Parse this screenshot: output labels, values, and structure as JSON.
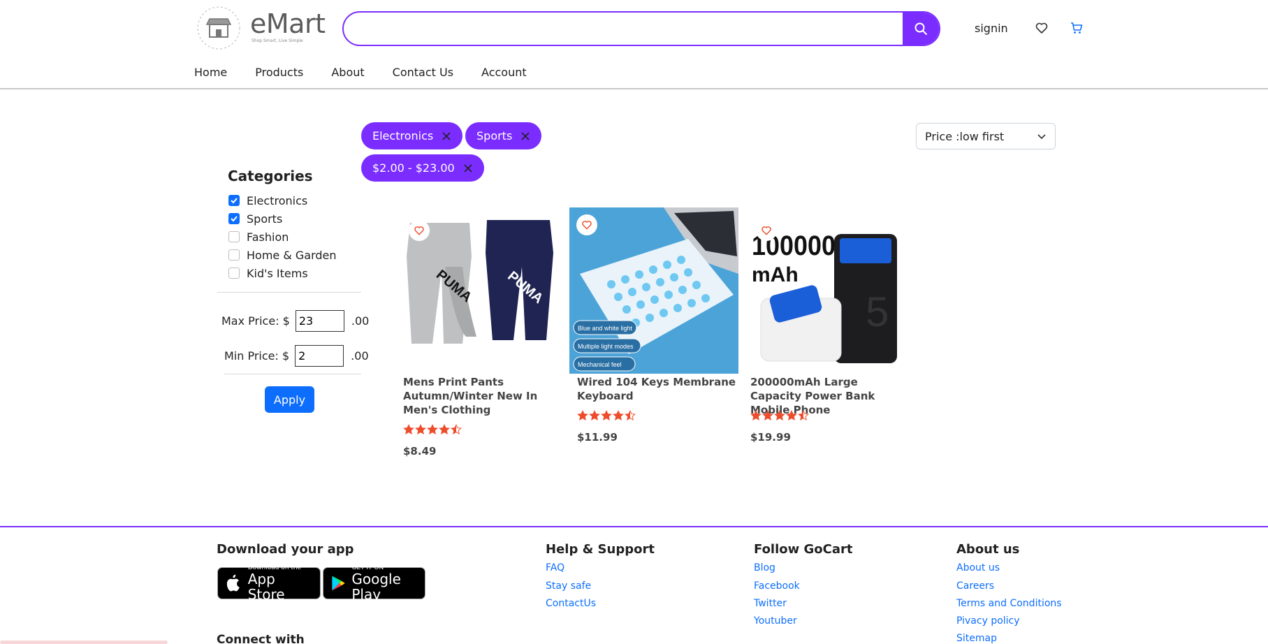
{
  "header": {
    "logo_text": "eMart",
    "logo_tagline": "Shop Smart, Live Simple",
    "search_placeholder": "",
    "signin_label": "signin"
  },
  "nav": [
    "Home",
    "Products",
    "About",
    "Contact Us",
    "Account"
  ],
  "filters": {
    "categories_title": "Categories",
    "categories": [
      {
        "label": "Electronics",
        "checked": true
      },
      {
        "label": "Sports",
        "checked": true
      },
      {
        "label": "Fashion",
        "checked": false
      },
      {
        "label": "Home & Garden",
        "checked": false
      },
      {
        "label": "Kid's Items",
        "checked": false
      }
    ],
    "max_price_label": "Max Price: $",
    "max_price_value": "23",
    "min_price_label": "Min Price: $",
    "min_price_value": "2",
    "cents_suffix": ".00",
    "apply_label": "Apply"
  },
  "active_chips": [
    "Electronics",
    "Sports",
    "$2.00 - $23.00"
  ],
  "sort": {
    "selected": "Price :low first"
  },
  "products": [
    {
      "name": "Mens Print Pants Autumn/Winter New In Men's Clothing",
      "rating": 4.5,
      "price": "$8.49"
    },
    {
      "name": "Wired 104 Keys Membrane Keyboard",
      "rating": 4.5,
      "price": "$11.99"
    },
    {
      "name": "200000mAh Large Capacity Power Bank Mobile Phone",
      "rating": 4.5,
      "price": "$19.99"
    }
  ],
  "product_image_text": {
    "pants_brand": "PUMA",
    "keyboard_labels": [
      "Blue and white light",
      "Multiple light modes",
      "Mechanical feel"
    ],
    "powerbank_big": "100000",
    "powerbank_unit": "mAh"
  },
  "footer": {
    "app_title": "Download your app",
    "app_store_small": "Download on the",
    "app_store_big": "App Store",
    "google_small": "GET IT ON",
    "google_big": "Google Play",
    "connect_title": "Connect with",
    "help_title": "Help & Support",
    "help_links": [
      "FAQ",
      "Stay safe",
      "ContactUs"
    ],
    "follow_title": "Follow GoCart",
    "follow_links": [
      "Blog",
      "Facebook",
      "Twitter",
      "Youtuber"
    ],
    "about_title": "About us",
    "about_links": [
      "About us",
      "Careers",
      "Terms and Conditions",
      "Pivacy policy",
      "Sitemap"
    ]
  },
  "colors": {
    "accent": "#7b2cff",
    "primary": "#0d6efd",
    "star": "#ee4d2d"
  }
}
